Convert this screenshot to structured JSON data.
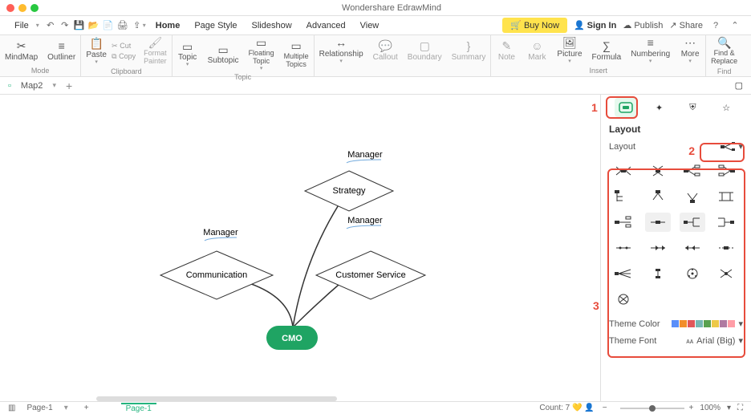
{
  "title": "Wondershare EdrawMind",
  "menu": {
    "file": "File",
    "items": [
      "Home",
      "Page Style",
      "Slideshow",
      "Advanced",
      "View"
    ],
    "buyNow": "Buy Now",
    "signIn": "Sign In",
    "publish": "Publish",
    "share": "Share"
  },
  "ribbon": {
    "mode": {
      "mindmap": "MindMap",
      "outliner": "Outliner",
      "label": "Mode"
    },
    "clipboard": {
      "paste": "Paste",
      "cut": "Cut",
      "copy": "Copy",
      "formatPainter": "Format\nPainter",
      "label": "Clipboard"
    },
    "topic": {
      "topic": "Topic",
      "subtopic": "Subtopic",
      "floating": "Floating\nTopic",
      "multiple": "Multiple\nTopics",
      "label": "Topic"
    },
    "relationship": "Relationship",
    "callout": "Callout",
    "boundary": "Boundary",
    "summary": "Summary",
    "insert": {
      "note": "Note",
      "mark": "Mark",
      "picture": "Picture",
      "formula": "Formula",
      "numbering": "Numbering",
      "more": "More",
      "label": "Insert"
    },
    "find": {
      "findReplace": "Find &\nReplace",
      "label": "Find"
    }
  },
  "tabs": {
    "map2": "Map2"
  },
  "diagram": {
    "center": "CMO",
    "nodes": {
      "communication": {
        "text": "Communication",
        "label": "Manager"
      },
      "strategy": {
        "text": "Strategy",
        "label": "Manager"
      },
      "customerService": {
        "text": "Customer Service",
        "label": "Manager"
      }
    }
  },
  "rpanel": {
    "layout": "Layout",
    "layoutRow": "Layout",
    "themeColor": "Theme Color",
    "themeFont": "Theme Font",
    "font": "Arial (Big)"
  },
  "bottom": {
    "page1": "Page-1",
    "pageActive": "Page-1",
    "count": "Count: 7",
    "zoom": "100%"
  },
  "callouts": {
    "one": "1",
    "two": "2",
    "three": "3"
  },
  "colors": [
    "#5B8FF9",
    "#F28E2B",
    "#E15759",
    "#76B7B2",
    "#59A14F",
    "#EDC948",
    "#B07AA1",
    "#FF9DA7"
  ]
}
